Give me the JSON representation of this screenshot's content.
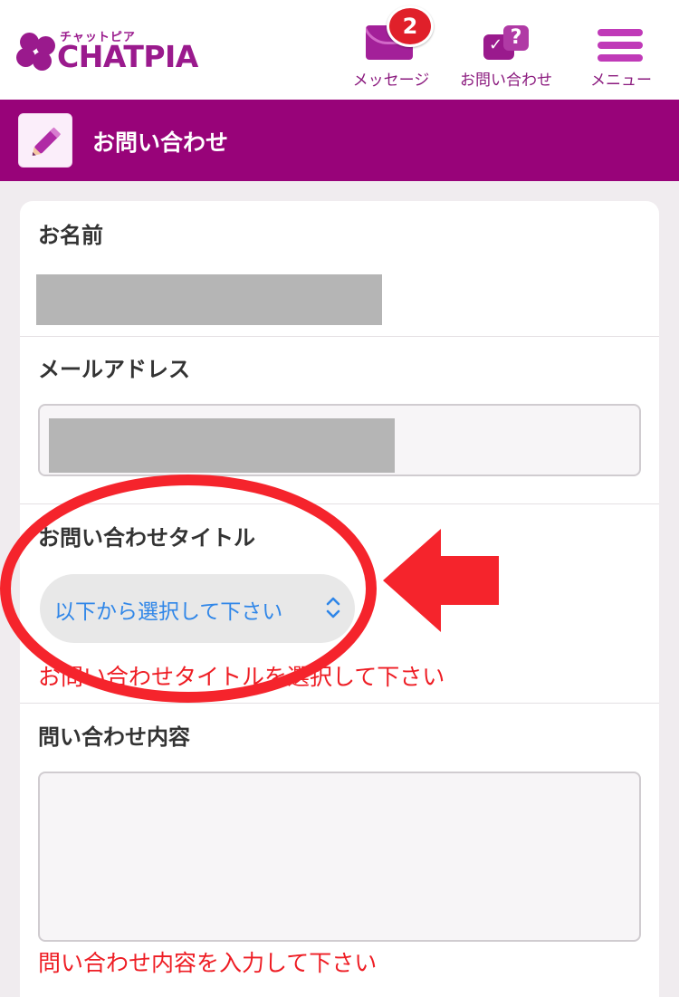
{
  "header": {
    "logo_kana": "チャットピア",
    "logo_text": "CHATPIA",
    "nav": {
      "messages_label": "メッセージ",
      "messages_count": "2",
      "contact_label": "お問い合わせ",
      "menu_label": "メニュー"
    }
  },
  "page": {
    "title": "お問い合わせ"
  },
  "form": {
    "name_label": "お名前",
    "email_label": "メールアドレス",
    "inquiry_title_label": "お問い合わせタイトル",
    "inquiry_title_select_value": "以下から選択して下さい",
    "inquiry_title_error": "お問い合わせタイトルを選択して下さい",
    "content_label": "問い合わせ内容",
    "content_value": "",
    "content_error": "問い合わせ内容を入力して下さい"
  },
  "colors": {
    "brand": "#980379",
    "error": "#ee1d24",
    "select_text": "#2f86e8",
    "annotation": "#f5242c"
  }
}
